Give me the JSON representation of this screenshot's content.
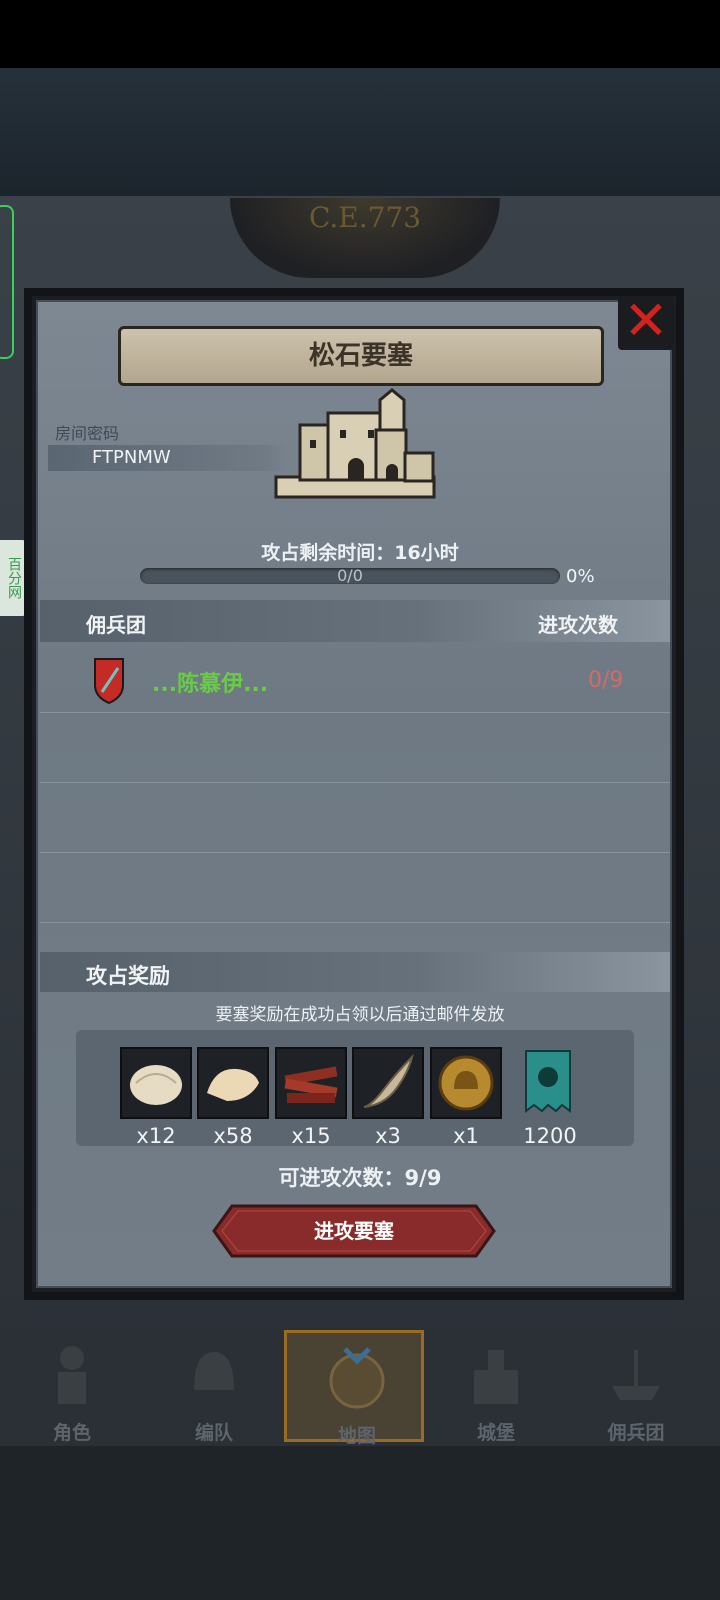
{
  "background": {
    "year_label": "C.E.773",
    "side_tag": "百分网"
  },
  "dialog": {
    "title": "松石要塞",
    "room": {
      "label": "房间密码",
      "code": "FTPNMW"
    },
    "capture_time": "攻占剩余时间：16小时",
    "progress": {
      "text": "0/0",
      "percent_label": "0%",
      "fraction": 0
    },
    "table": {
      "left_header": "佣兵团",
      "right_header": "进攻次数",
      "rows": [
        {
          "name": "...陈慕伊...",
          "count": "0/9"
        }
      ]
    },
    "rewards": {
      "title": "攻占奖励",
      "note": "要塞奖励在成功占领以后通过邮件发放",
      "items": [
        {
          "icon": "fur-pelt-icon",
          "qty": "x12"
        },
        {
          "icon": "fur-hide-icon",
          "qty": "x58"
        },
        {
          "icon": "wood-logs-icon",
          "qty": "x15"
        },
        {
          "icon": "horn-icon",
          "qty": "x3"
        },
        {
          "icon": "helmet-coin-icon",
          "qty": "x1"
        },
        {
          "icon": "guild-banner-icon",
          "qty": "1200"
        }
      ]
    },
    "attacks_left": "可进攻次数：9/9",
    "attack_button": "进攻要塞"
  },
  "nav": [
    {
      "label": "角色"
    },
    {
      "label": "编队"
    },
    {
      "label": "地图"
    },
    {
      "label": "城堡"
    },
    {
      "label": "佣兵团"
    }
  ],
  "colors": {
    "member_name": "#6acc46",
    "member_count": "#d46a6a",
    "close": "#d4221d",
    "button": "#8a2b2b"
  }
}
